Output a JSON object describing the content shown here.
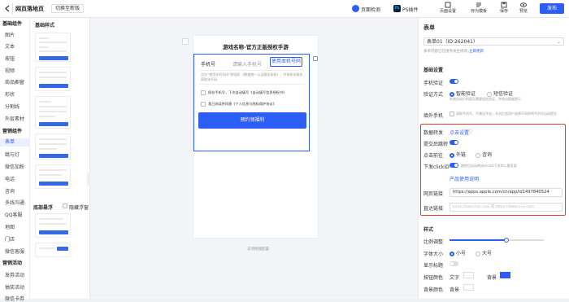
{
  "topbar": {
    "app_title": "网页落地页",
    "switch_label": "切换至新版",
    "tools": [
      {
        "label": "页面检测",
        "icon": "check-shield-icon"
      },
      {
        "label": "PS插件",
        "icon": "ps-plugin-icon"
      },
      {
        "label": "页面设置",
        "icon": "page-settings-icon"
      },
      {
        "label": "存为模板",
        "icon": "save-template-icon"
      },
      {
        "label": "保存",
        "icon": "save-icon"
      },
      {
        "label": "预览",
        "icon": "preview-icon"
      }
    ],
    "publish_label": "发布",
    "ps_badge": "Ps"
  },
  "sidebar": {
    "groups": [
      {
        "title": "基础组件",
        "items": [
          "图片",
          "文本",
          "按钮",
          "视频",
          "商品橱窗",
          "形状",
          "分割线",
          "外层素材"
        ]
      },
      {
        "title": "营销组件",
        "items": [
          "表单",
          "跳与灯",
          "微信加粉",
          "电话",
          "咨询",
          "多线沟通",
          "QQ客服",
          "地图",
          "门店",
          "微信客服"
        ]
      },
      {
        "title": "营销活动",
        "items": [
          "发券活动",
          "抽奖活动",
          "微信卡券"
        ]
      }
    ],
    "active_item": "表单"
  },
  "components": {
    "section_title": "基础样式",
    "bottom_title": "底部悬浮",
    "bottom_check_label": "隐藏浮窗"
  },
  "canvas": {
    "page_title": "游戏名称-官方正版授权手游",
    "phone_label": "手机号",
    "phone_placeholder": "请输入手机号",
    "use_phone_button": "使用本机号码",
    "hint": "点击“使用本机号码”按钮即 《数据统一认证服务条款》，并授权本服务获取该号码",
    "privacy1": "保存手机号，下次自动填写《自动填写信息授权书》",
    "privacy2": "我已阅读并同意《个人信息与隐私保护协议》",
    "submit_label": "预约领福利",
    "footer_text": "支持拖拽配置"
  },
  "panel": {
    "title": "表单",
    "form_select": "表单01（ID:262041）",
    "form_note": "表单内容已在组件发生修改，",
    "form_note_link": "立即更新",
    "basic_title": "基础设置",
    "phone_verify_label": "手机验证",
    "verify_mode_label": "验证方式",
    "verify_smart": "智能验证",
    "verify_sms": "短信验证",
    "verify_note": "系统自动识别是否需要短信验证，并给出智能提示",
    "auth_label": "填外手机",
    "auth_note": "获取手机号，不建议开启，开启后若用户选择不同则将手机号自动提交",
    "data_return_label": "数据转发",
    "data_return_link": "点击设置",
    "submit_jump_label": "提交后跳转",
    "click_goto_label": "点击前往",
    "goto_option1": "外链",
    "goto_option2": "咨询",
    "download_label": "下发clickID",
    "download_note": "跳转后自动转成clickid下发到二跳页面",
    "product_link": "产品使用说明",
    "web_link_label": "网页链接",
    "web_link_value": "https://apps.apple.com/cn/app/id1497840524",
    "direct_link_label": "直达链接",
    "direct_link_placeholder": "xxxx://xxxx?xx=xxx 或 https://www.xxx.com",
    "style_title": "样式",
    "scale_label": "比例调整",
    "scale_value": 0.6,
    "font_size_label": "字体大小",
    "font_small": "小号",
    "font_large": "大号",
    "show_title_label": "显示标题",
    "btn_color_label": "按钮颜色",
    "btn_text_label": "文字",
    "btn_bg_label": "背景",
    "bg_color_label": "背景颜色",
    "bg_label": "背景"
  },
  "colors": {
    "accent": "#2c5ef5",
    "highlight_border": "#e53935"
  }
}
